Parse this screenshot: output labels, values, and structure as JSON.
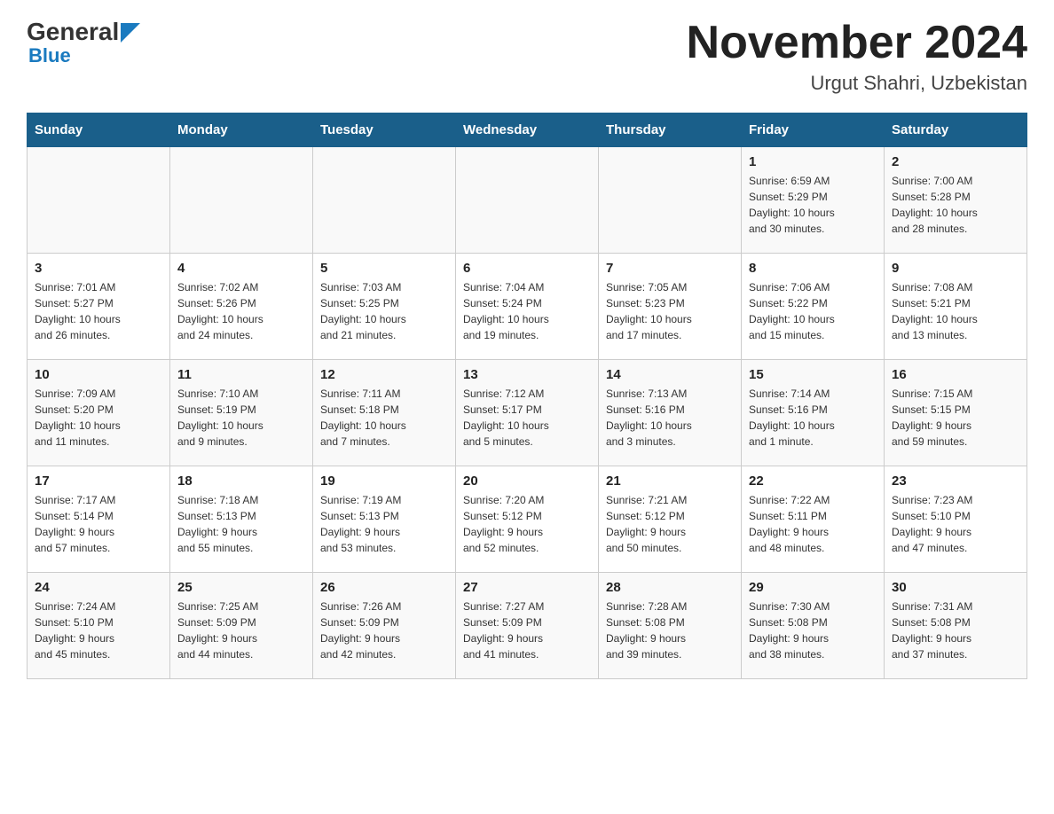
{
  "header": {
    "logo_general": "General",
    "logo_blue": "Blue",
    "title": "November 2024",
    "location": "Urgut Shahri, Uzbekistan"
  },
  "days_of_week": [
    "Sunday",
    "Monday",
    "Tuesday",
    "Wednesday",
    "Thursday",
    "Friday",
    "Saturday"
  ],
  "weeks": [
    {
      "days": [
        {
          "date": "",
          "info": ""
        },
        {
          "date": "",
          "info": ""
        },
        {
          "date": "",
          "info": ""
        },
        {
          "date": "",
          "info": ""
        },
        {
          "date": "",
          "info": ""
        },
        {
          "date": "1",
          "info": "Sunrise: 6:59 AM\nSunset: 5:29 PM\nDaylight: 10 hours\nand 30 minutes."
        },
        {
          "date": "2",
          "info": "Sunrise: 7:00 AM\nSunset: 5:28 PM\nDaylight: 10 hours\nand 28 minutes."
        }
      ]
    },
    {
      "days": [
        {
          "date": "3",
          "info": "Sunrise: 7:01 AM\nSunset: 5:27 PM\nDaylight: 10 hours\nand 26 minutes."
        },
        {
          "date": "4",
          "info": "Sunrise: 7:02 AM\nSunset: 5:26 PM\nDaylight: 10 hours\nand 24 minutes."
        },
        {
          "date": "5",
          "info": "Sunrise: 7:03 AM\nSunset: 5:25 PM\nDaylight: 10 hours\nand 21 minutes."
        },
        {
          "date": "6",
          "info": "Sunrise: 7:04 AM\nSunset: 5:24 PM\nDaylight: 10 hours\nand 19 minutes."
        },
        {
          "date": "7",
          "info": "Sunrise: 7:05 AM\nSunset: 5:23 PM\nDaylight: 10 hours\nand 17 minutes."
        },
        {
          "date": "8",
          "info": "Sunrise: 7:06 AM\nSunset: 5:22 PM\nDaylight: 10 hours\nand 15 minutes."
        },
        {
          "date": "9",
          "info": "Sunrise: 7:08 AM\nSunset: 5:21 PM\nDaylight: 10 hours\nand 13 minutes."
        }
      ]
    },
    {
      "days": [
        {
          "date": "10",
          "info": "Sunrise: 7:09 AM\nSunset: 5:20 PM\nDaylight: 10 hours\nand 11 minutes."
        },
        {
          "date": "11",
          "info": "Sunrise: 7:10 AM\nSunset: 5:19 PM\nDaylight: 10 hours\nand 9 minutes."
        },
        {
          "date": "12",
          "info": "Sunrise: 7:11 AM\nSunset: 5:18 PM\nDaylight: 10 hours\nand 7 minutes."
        },
        {
          "date": "13",
          "info": "Sunrise: 7:12 AM\nSunset: 5:17 PM\nDaylight: 10 hours\nand 5 minutes."
        },
        {
          "date": "14",
          "info": "Sunrise: 7:13 AM\nSunset: 5:16 PM\nDaylight: 10 hours\nand 3 minutes."
        },
        {
          "date": "15",
          "info": "Sunrise: 7:14 AM\nSunset: 5:16 PM\nDaylight: 10 hours\nand 1 minute."
        },
        {
          "date": "16",
          "info": "Sunrise: 7:15 AM\nSunset: 5:15 PM\nDaylight: 9 hours\nand 59 minutes."
        }
      ]
    },
    {
      "days": [
        {
          "date": "17",
          "info": "Sunrise: 7:17 AM\nSunset: 5:14 PM\nDaylight: 9 hours\nand 57 minutes."
        },
        {
          "date": "18",
          "info": "Sunrise: 7:18 AM\nSunset: 5:13 PM\nDaylight: 9 hours\nand 55 minutes."
        },
        {
          "date": "19",
          "info": "Sunrise: 7:19 AM\nSunset: 5:13 PM\nDaylight: 9 hours\nand 53 minutes."
        },
        {
          "date": "20",
          "info": "Sunrise: 7:20 AM\nSunset: 5:12 PM\nDaylight: 9 hours\nand 52 minutes."
        },
        {
          "date": "21",
          "info": "Sunrise: 7:21 AM\nSunset: 5:12 PM\nDaylight: 9 hours\nand 50 minutes."
        },
        {
          "date": "22",
          "info": "Sunrise: 7:22 AM\nSunset: 5:11 PM\nDaylight: 9 hours\nand 48 minutes."
        },
        {
          "date": "23",
          "info": "Sunrise: 7:23 AM\nSunset: 5:10 PM\nDaylight: 9 hours\nand 47 minutes."
        }
      ]
    },
    {
      "days": [
        {
          "date": "24",
          "info": "Sunrise: 7:24 AM\nSunset: 5:10 PM\nDaylight: 9 hours\nand 45 minutes."
        },
        {
          "date": "25",
          "info": "Sunrise: 7:25 AM\nSunset: 5:09 PM\nDaylight: 9 hours\nand 44 minutes."
        },
        {
          "date": "26",
          "info": "Sunrise: 7:26 AM\nSunset: 5:09 PM\nDaylight: 9 hours\nand 42 minutes."
        },
        {
          "date": "27",
          "info": "Sunrise: 7:27 AM\nSunset: 5:09 PM\nDaylight: 9 hours\nand 41 minutes."
        },
        {
          "date": "28",
          "info": "Sunrise: 7:28 AM\nSunset: 5:08 PM\nDaylight: 9 hours\nand 39 minutes."
        },
        {
          "date": "29",
          "info": "Sunrise: 7:30 AM\nSunset: 5:08 PM\nDaylight: 9 hours\nand 38 minutes."
        },
        {
          "date": "30",
          "info": "Sunrise: 7:31 AM\nSunset: 5:08 PM\nDaylight: 9 hours\nand 37 minutes."
        }
      ]
    }
  ]
}
